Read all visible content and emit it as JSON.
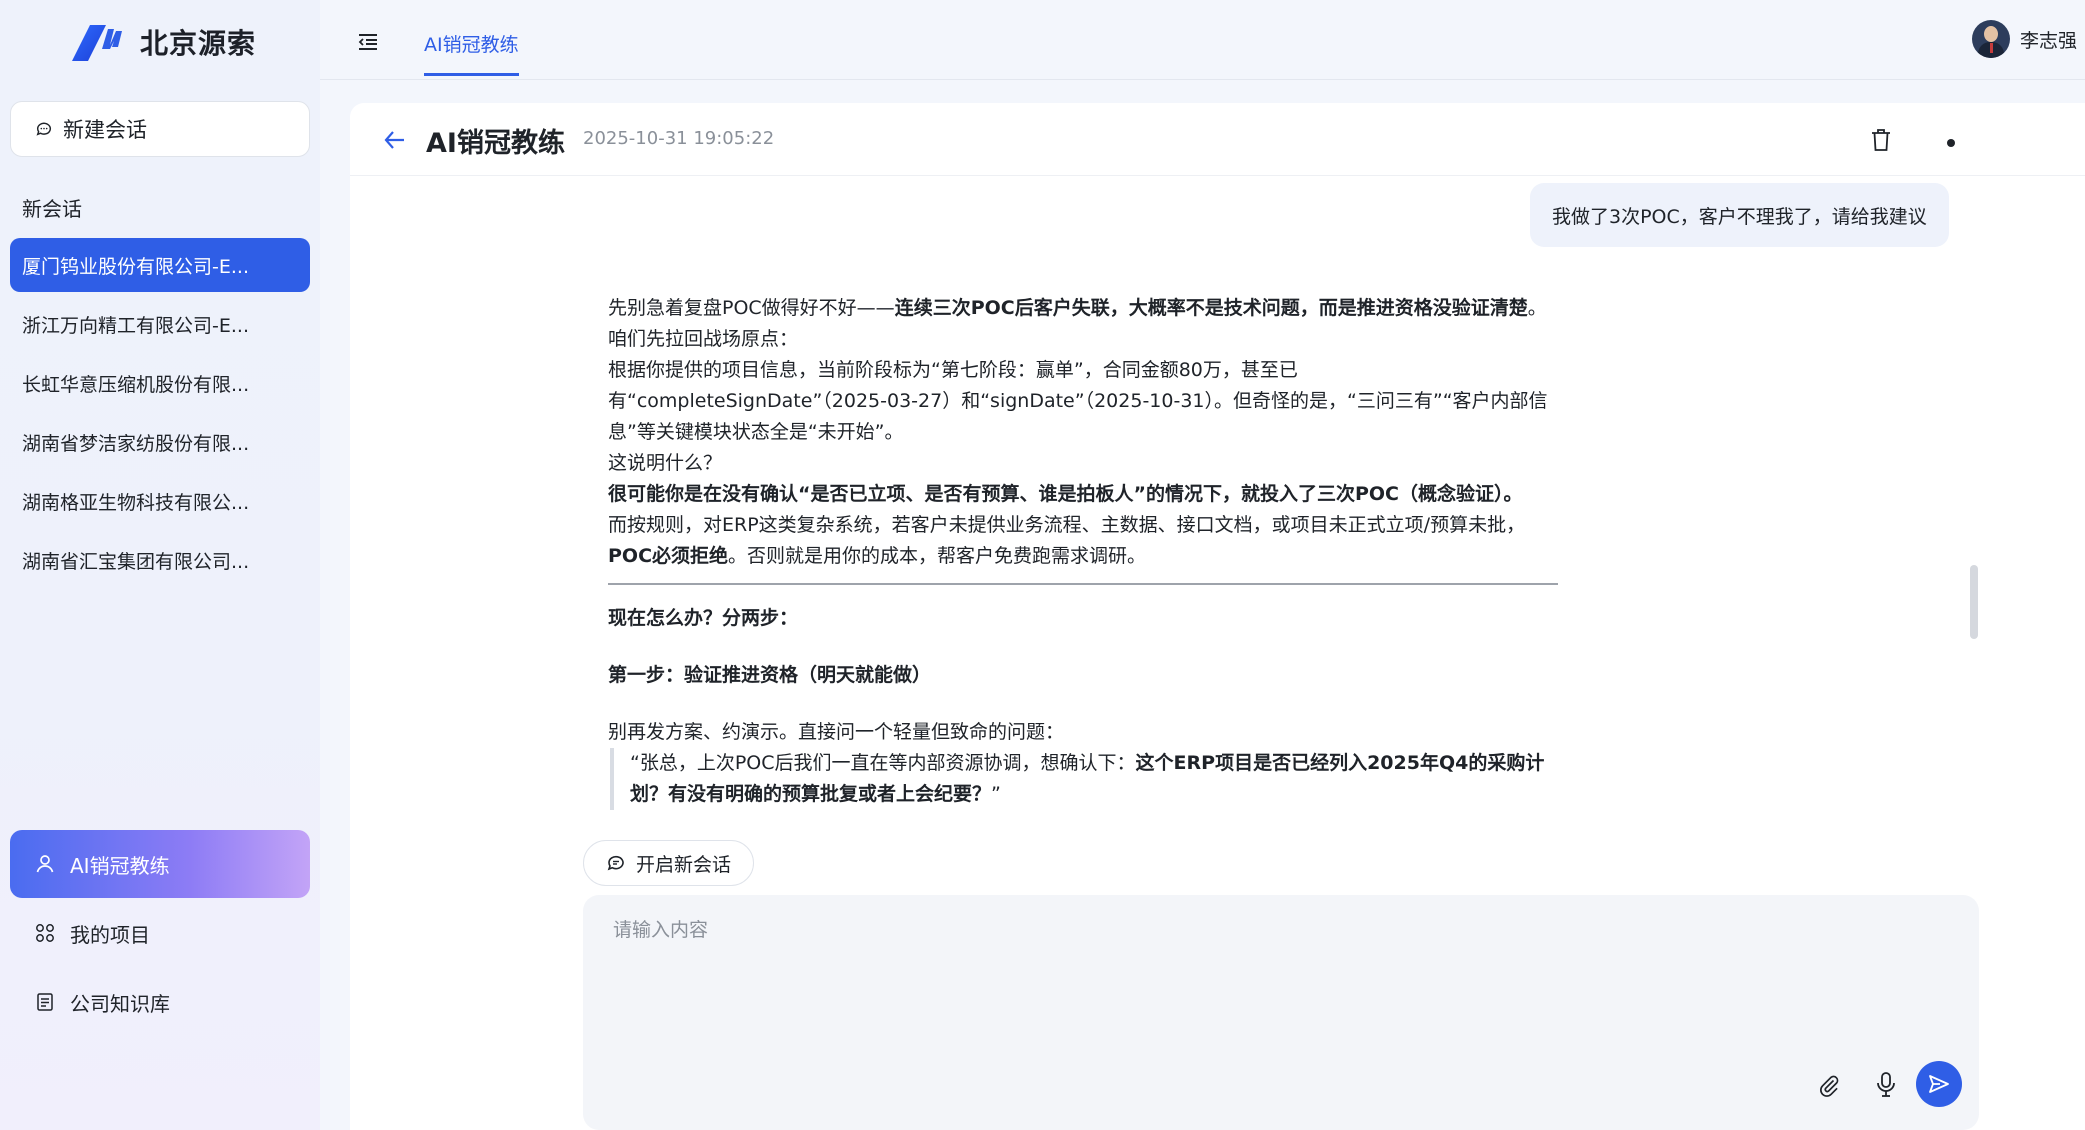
{
  "brand": {
    "name": "北京源索",
    "logo_icon": "brand-logo"
  },
  "sidebar": {
    "new_chat_label": "新建会话",
    "section_label": "新会话",
    "conversations": [
      {
        "label": "厦门钨业股份有限公司-E...",
        "active": true
      },
      {
        "label": "浙江万向精工有限公司-E..."
      },
      {
        "label": "长虹华意压缩机股份有限..."
      },
      {
        "label": "湖南省梦洁家纺股份有限..."
      },
      {
        "label": "湖南格亚生物科技有限公..."
      },
      {
        "label": "湖南省汇宝集团有限公司..."
      }
    ],
    "nav": [
      {
        "label": "AI销冠教练",
        "icon": "user-icon",
        "active": true
      },
      {
        "label": "我的项目",
        "icon": "grid-icon"
      },
      {
        "label": "公司知识库",
        "icon": "document-icon"
      }
    ]
  },
  "topbar": {
    "tab_label": "AI销冠教练",
    "user_name": "李志强"
  },
  "chat": {
    "title": "AI销冠教练",
    "timestamp": "2025-10-31 19:05:22",
    "user_message": "我做了3次POC，客户不理我了，请给我建议",
    "answer": {
      "p1_a": "先别急着复盘POC做得好不好——",
      "p1_b": "连续三次POC后客户失联，大概率不是技术问题，而是推进资格没验证清楚",
      "p1_c": "。",
      "p2": "咱们先拉回战场原点：",
      "p3": "根据你提供的项目信息，当前阶段标为“第七阶段：赢单”，合同金额80万，甚至已有“completeSignDate”（2025-03-27）和“signDate”（2025-10-31）。但奇怪的是，“三问三有”“客户内部信息”等关键模块状态全是“未开始”。",
      "p4": "这说明什么？",
      "p5": "很可能你是在没有确认“是否已立项、是否有预算、谁是拍板人”的情况下，就投入了三次POC（概念验证）。",
      "p6_a": "而按规则，对ERP这类复杂系统，若客户未提供业务流程、主数据、接口文档，或项目未正式立项/预算未批，",
      "p6_b": "POC必须拒绝",
      "p6_c": "。否则就是用你的成本，帮客户免费跑需求调研。",
      "h1": "现在怎么办？分两步：",
      "h2": "第一步：验证推进资格（明天就能做）",
      "p7": "别再发方案、约演示。直接问一个轻量但致命的问题：",
      "q_a": "“张总，上次POC后我们一直在等内部资源协调，想确认下：",
      "q_b": "这个ERP项目是否已经列入2025年Q4的采购计划？有没有明确的预算批复或者上会纪要？",
      "q_c": "”"
    },
    "start_new_label": "开启新会话",
    "input_placeholder": "请输入内容"
  },
  "colors": {
    "accent": "#2f5ee6",
    "gradient_end": "#c3a4f7"
  }
}
